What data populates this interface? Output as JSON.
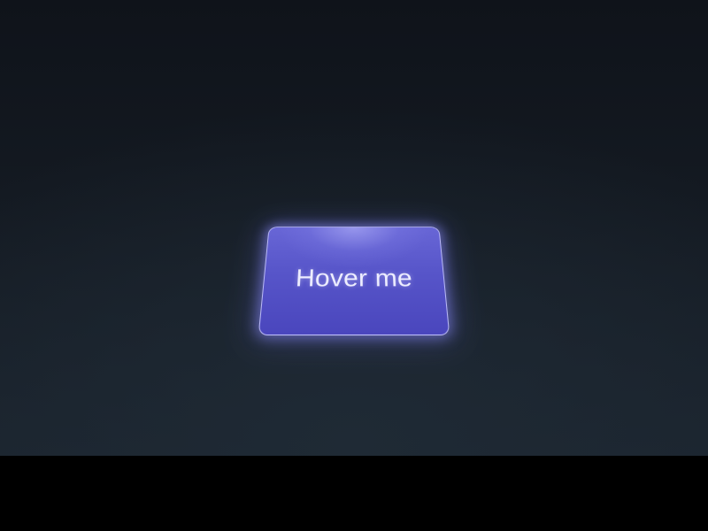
{
  "card": {
    "label": "Hover me"
  },
  "colors": {
    "background_top": "#0f131a",
    "background_bottom": "#1b242e",
    "card_fill": "#5755c9",
    "card_border": "#cdcdff",
    "card_glow": "#8c8cff",
    "label_text": "#eeeeff",
    "bottom_bar": "#000000"
  }
}
